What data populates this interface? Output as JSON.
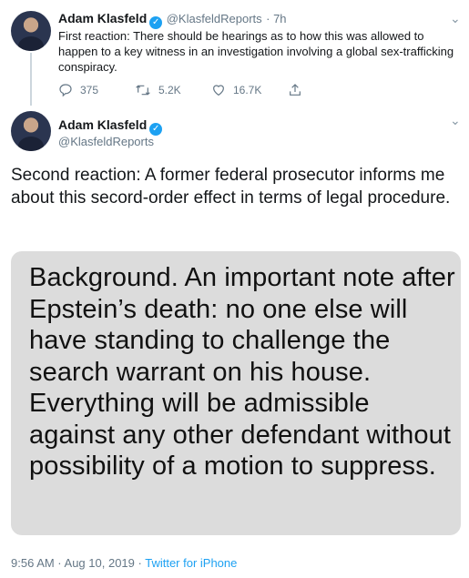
{
  "tweet1": {
    "name": "Adam Klasfeld",
    "handle": "@KlasfeldReports",
    "time": "· 7h",
    "text": "First reaction: There should be hearings as to how this was allowed to happen to a key witness in an investigation involving a global sex-trafficking conspiracy.",
    "replies": "375",
    "retweets": "5.2K",
    "likes": "16.7K"
  },
  "tweet2": {
    "name": "Adam Klasfeld",
    "handle": "@KlasfeldReports",
    "text": "Second reaction: A former federal prosecutor informs me about this secord-order effect in terms of legal procedure.",
    "image_text": "Background. An important note after Epstein’s death: no one else will have standing to challenge the search warrant on his house. Everything will be admissible against any other defendant without possibility of a motion to suppress.",
    "timestamp": "9:56 AM · Aug 10, 2019",
    "separator": " · ",
    "source": "Twitter for iPhone"
  },
  "icons": [
    "reply-icon",
    "retweet-icon",
    "like-icon",
    "share-icon",
    "verified-icon",
    "chevron-down-icon"
  ],
  "colors": {
    "accent": "#1da1f2",
    "muted": "#657786",
    "text": "#14171a",
    "media_bg": "#dcdcdc"
  }
}
